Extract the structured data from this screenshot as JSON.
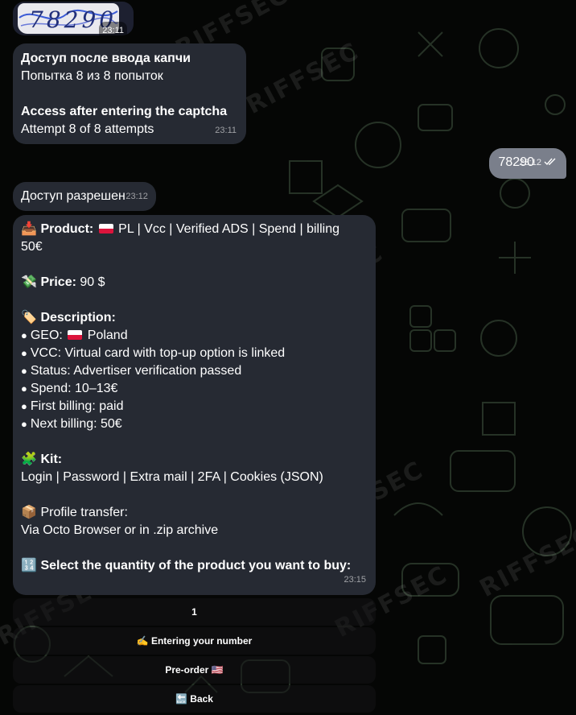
{
  "watermark": "RIFFSEC",
  "captcha": {
    "image_text": "78290",
    "time": "23:11"
  },
  "access_message": {
    "ru_title": "Доступ после ввода капчи",
    "ru_attempt": "Попытка 8 из 8 попыток",
    "en_title": "Access after entering the captcha",
    "en_attempt": "Attempt 8 of 8 attempts",
    "time": "23:11"
  },
  "outgoing": {
    "text": "78290",
    "time": "23:12",
    "status_icon": "double-check-icon"
  },
  "granted": {
    "text": "Доступ разрешен",
    "time": "23:12"
  },
  "product": {
    "icon": "inbox-tray-icon",
    "product_label": "Product:",
    "product_value_line1": "PL | Vcc | Verified ADS | Spend | billing",
    "product_value_line2": "50€",
    "price_icon": "money-wings-icon",
    "price_label": "Price:",
    "price_value": "90 $",
    "desc_icon": "label-tag-icon",
    "desc_label": "Description:",
    "desc_items": [
      "GEO:",
      "VCC: Virtual card with top-up option is linked",
      "Status: Advertiser verification passed",
      "Spend: 10–13€",
      "First billing: paid",
      "Next billing: 50€"
    ],
    "geo_value": "Poland",
    "kit_icon": "puzzle-piece-icon",
    "kit_label": "Kit:",
    "kit_value": "Login | Password | Extra mail | 2FA | Cookies (JSON)",
    "transfer_icon": "package-icon",
    "transfer_label": "Profile transfer:",
    "transfer_value": "Via Octo Browser or in .zip archive",
    "select_icon": "numbers-1234-icon",
    "select_label": "Select the quantity of the product you want to buy:",
    "time": "23:15"
  },
  "buttons": {
    "quantity": "1",
    "entering": "Entering your number",
    "entering_icon": "writing-hand-icon",
    "preorder": "Pre-order",
    "preorder_icon": "us-flag-icon",
    "back": "Back",
    "back_icon": "back-arrow-icon"
  },
  "colors": {
    "background": "#050605",
    "bubble": "#262a33",
    "outgoing_bubble": "#7a7f8b",
    "flag_red": "#dc143c"
  }
}
